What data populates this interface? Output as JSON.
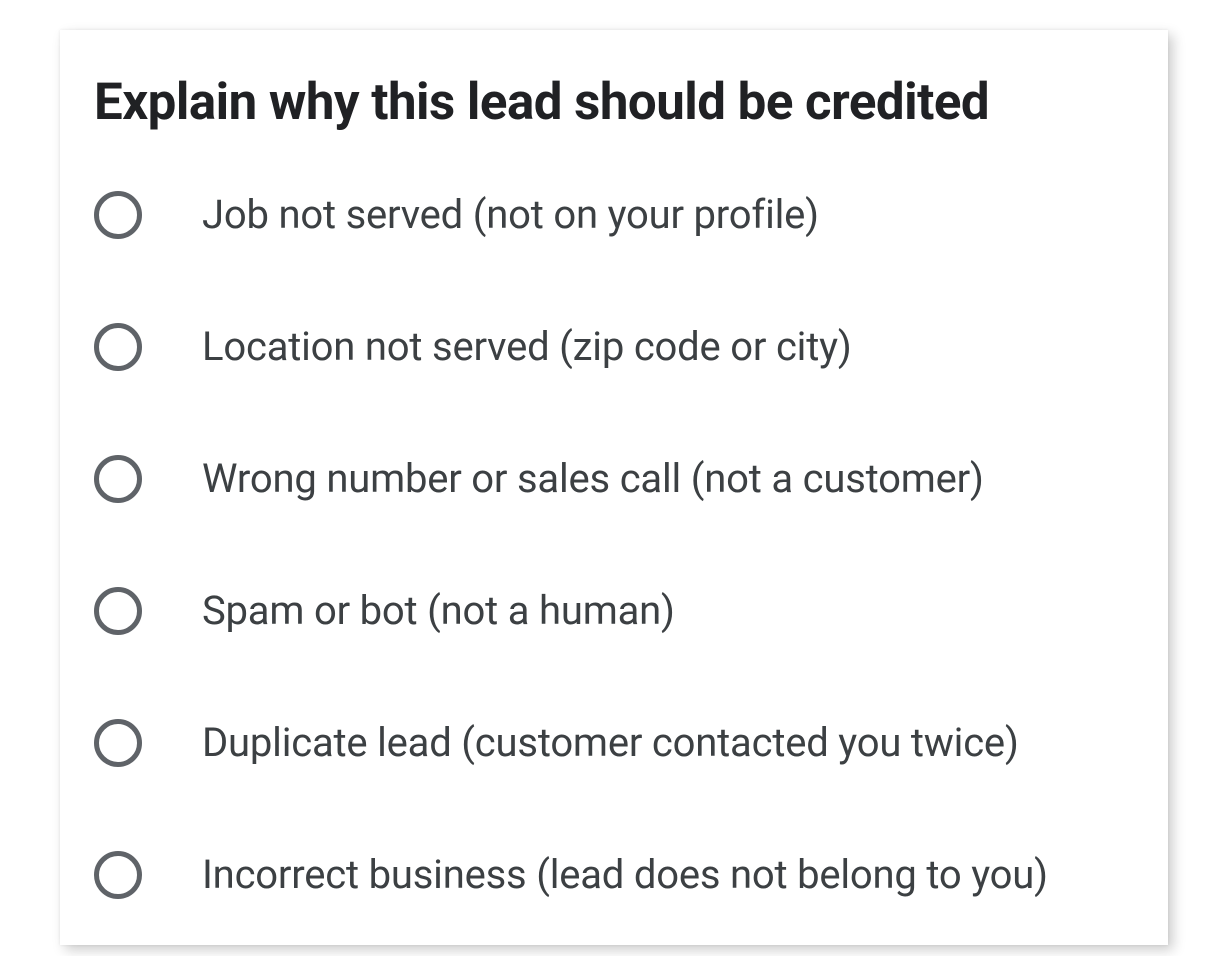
{
  "card": {
    "title": "Explain why this lead should be credited",
    "options": [
      {
        "label": "Job not served (not on your profile)"
      },
      {
        "label": "Location not served (zip code or city)"
      },
      {
        "label": "Wrong number or sales call (not a customer)"
      },
      {
        "label": "Spam or bot (not a human)"
      },
      {
        "label": "Duplicate lead (customer contacted you twice)"
      },
      {
        "label": "Incorrect business (lead does not belong to you)"
      }
    ]
  }
}
